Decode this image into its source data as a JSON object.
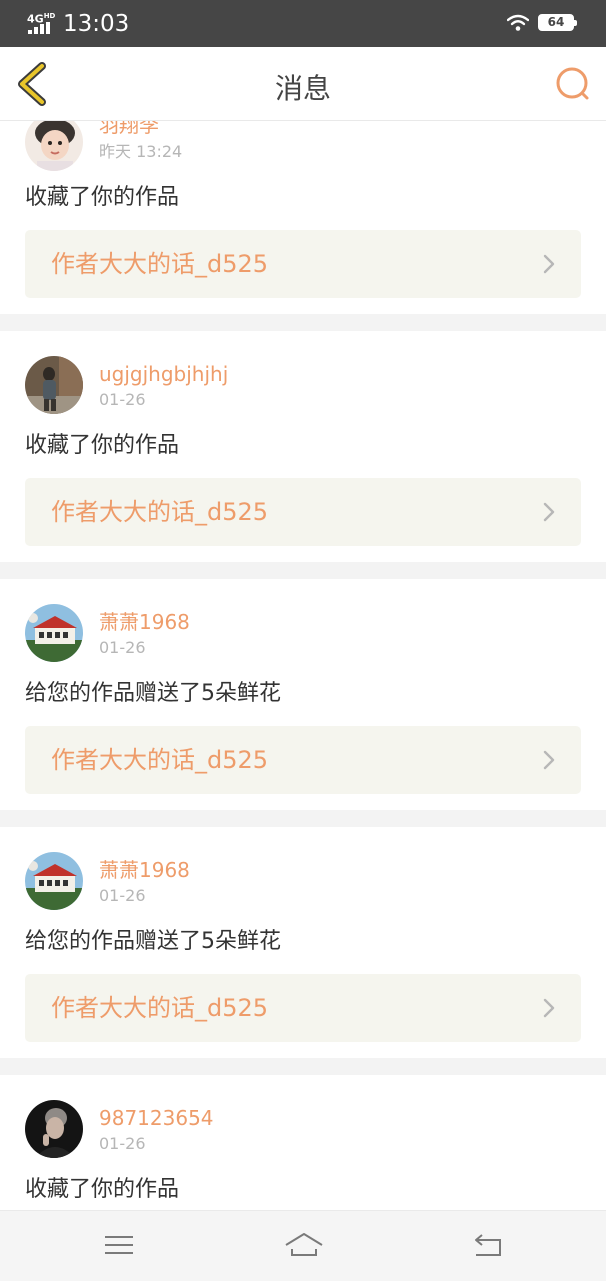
{
  "status_bar": {
    "network": "4G",
    "network_sup": "HD",
    "time": "13:03",
    "battery": "64"
  },
  "header": {
    "title": "消息",
    "back_icon": "chevron-left-icon",
    "search_icon": "search-icon"
  },
  "colors": {
    "accent": "#ee9c6a",
    "back_yellow": "#e8c52a",
    "card_bg": "#f5f5ee"
  },
  "messages": [
    {
      "username": "羽翔李",
      "time": "昨天 13:24",
      "action": "收藏了你的作品",
      "work_title": "作者大大的话_d525"
    },
    {
      "username": "ugjgjhgbjhjhj",
      "time": "01-26",
      "action": "收藏了你的作品",
      "work_title": "作者大大的话_d525"
    },
    {
      "username": "萧萧1968",
      "time": "01-26",
      "action": "给您的作品赠送了5朵鲜花",
      "work_title": "作者大大的话_d525"
    },
    {
      "username": "萧萧1968",
      "time": "01-26",
      "action": "给您的作品赠送了5朵鲜花",
      "work_title": "作者大大的话_d525"
    },
    {
      "username": "987123654",
      "time": "01-26",
      "action": "收藏了你的作品",
      "work_title": ""
    }
  ],
  "nav_bar": {
    "menu_icon": "menu-icon",
    "home_icon": "home-icon",
    "back_icon": "return-icon"
  }
}
